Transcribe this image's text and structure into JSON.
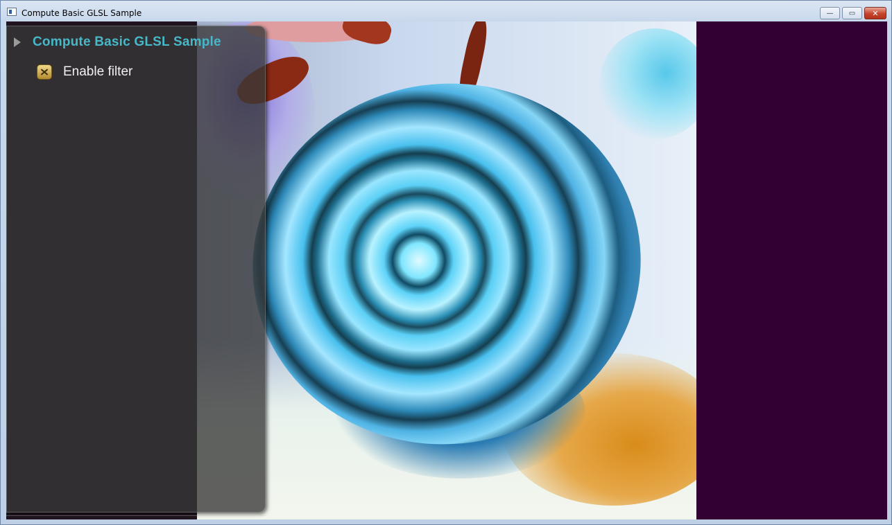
{
  "window": {
    "title": "Compute Basic GLSL Sample",
    "controls": {
      "minimize": "—",
      "maximize": "▭",
      "close": "✕"
    }
  },
  "viewport": {
    "background_color": "#330033",
    "image_description_icon": "rose-image"
  },
  "overlay_menu": {
    "title": "Compute Basic GLSL Sample",
    "title_color": "#46b8c8",
    "title_icon": "collapse-triangle-icon",
    "items": [
      {
        "label": "Enable filter",
        "icon": "checkbox-icon",
        "checked": true
      }
    ]
  }
}
